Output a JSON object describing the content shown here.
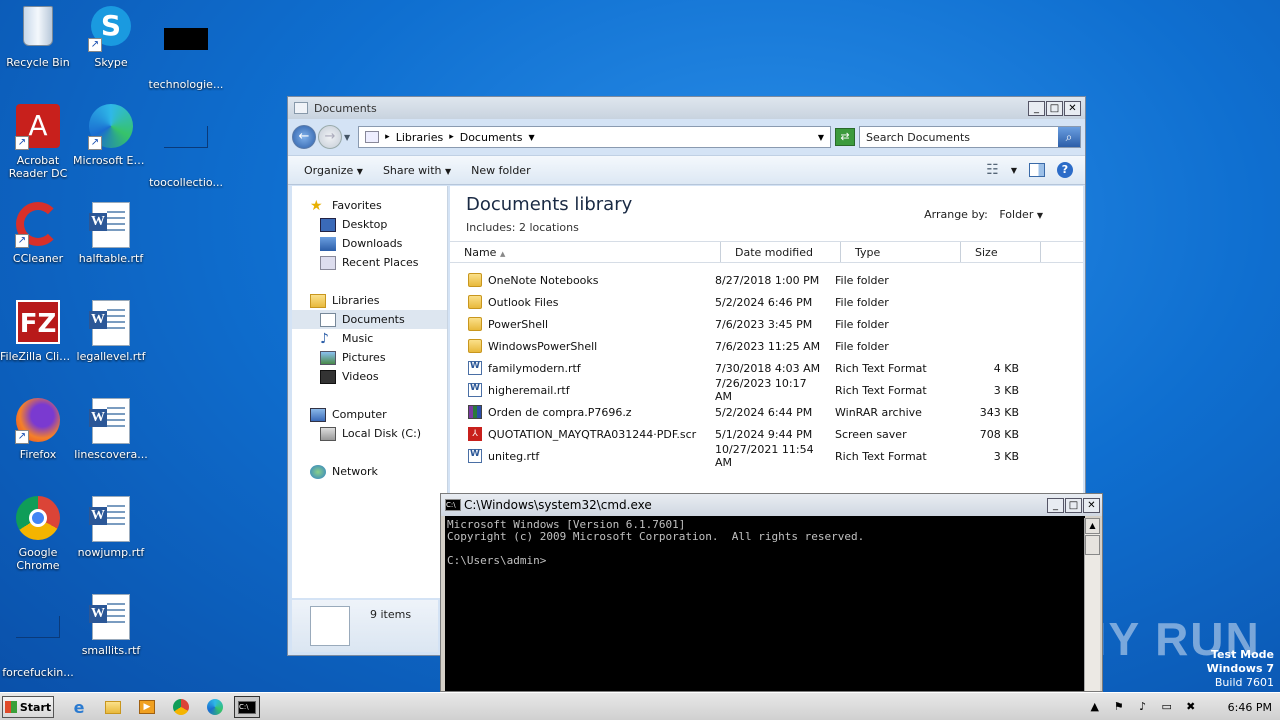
{
  "desktop": {
    "icons": [
      {
        "label": "Recycle Bin"
      },
      {
        "label": "Skype"
      },
      {
        "label": "technologie..."
      },
      {
        "label": "Acrobat Reader DC"
      },
      {
        "label": "Microsoft Edge"
      },
      {
        "label": "toocollectio..."
      },
      {
        "label": "CCleaner"
      },
      {
        "label": "halftable.rtf"
      },
      {
        "label": "FileZilla Client"
      },
      {
        "label": "legallevel.rtf"
      },
      {
        "label": "Firefox"
      },
      {
        "label": "linescovera..."
      },
      {
        "label": "Google Chrome"
      },
      {
        "label": "nowjump.rtf"
      },
      {
        "label": "forcefuckin..."
      },
      {
        "label": "smallits.rtf"
      }
    ]
  },
  "explorer": {
    "title": "Documents",
    "breadcrumb": [
      "Libraries",
      "Documents"
    ],
    "search_placeholder": "Search Documents",
    "toolbar": {
      "organize": "Organize",
      "share_with": "Share with",
      "new_folder": "New folder"
    },
    "nav": {
      "favorites": "Favorites",
      "desktop": "Desktop",
      "downloads": "Downloads",
      "recent_places": "Recent Places",
      "libraries": "Libraries",
      "documents": "Documents",
      "music": "Music",
      "pictures": "Pictures",
      "videos": "Videos",
      "computer": "Computer",
      "local_disk": "Local Disk (C:)",
      "network": "Network"
    },
    "library_title": "Documents library",
    "library_includes": "Includes:  2 locations",
    "arrange_by_label": "Arrange by:",
    "arrange_by_value": "Folder",
    "columns": {
      "name": "Name",
      "date": "Date modified",
      "type": "Type",
      "size": "Size"
    },
    "files": [
      {
        "name": "OneNote Notebooks",
        "date": "8/27/2018 1:00 PM",
        "type": "File folder",
        "size": "",
        "icon": "folder"
      },
      {
        "name": "Outlook Files",
        "date": "5/2/2024 6:46 PM",
        "type": "File folder",
        "size": "",
        "icon": "folder"
      },
      {
        "name": "PowerShell",
        "date": "7/6/2023 3:45 PM",
        "type": "File folder",
        "size": "",
        "icon": "folder"
      },
      {
        "name": "WindowsPowerShell",
        "date": "7/6/2023 11:25 AM",
        "type": "File folder",
        "size": "",
        "icon": "folder"
      },
      {
        "name": "familymodern.rtf",
        "date": "7/30/2018 4:03 AM",
        "type": "Rich Text Format",
        "size": "4 KB",
        "icon": "rtf"
      },
      {
        "name": "higheremail.rtf",
        "date": "7/26/2023 10:17 AM",
        "type": "Rich Text Format",
        "size": "3 KB",
        "icon": "rtf"
      },
      {
        "name": "Orden de compra.P7696.z",
        "date": "5/2/2024 6:44 PM",
        "type": "WinRAR archive",
        "size": "343 KB",
        "icon": "rar"
      },
      {
        "name": "QUOTATION_MAYQTRA031244·PDF.scr",
        "date": "5/1/2024 9:44 PM",
        "type": "Screen saver",
        "size": "708 KB",
        "icon": "pdf"
      },
      {
        "name": "uniteg.rtf",
        "date": "10/27/2021 11:54 AM",
        "type": "Rich Text Format",
        "size": "3 KB",
        "icon": "rtf"
      }
    ],
    "item_count": "9 items"
  },
  "cmd": {
    "title": "C:\\Windows\\system32\\cmd.exe",
    "output": "Microsoft Windows [Version 6.1.7601]\nCopyright (c) 2009 Microsoft Corporation.  All rights reserved.\n\nC:\\Users\\admin>"
  },
  "watermark": {
    "brand": "ANY RUN",
    "test_mode": "Test Mode",
    "os": "Windows 7",
    "build": "Build 7601"
  },
  "taskbar": {
    "start_label": "Start",
    "clock": "6:46 PM"
  },
  "colors": {
    "desktop_bg": "#0f6fd0",
    "selection": "#dde6f0",
    "cmd_bg": "#000000",
    "cmd_text": "#c0c0c0"
  }
}
